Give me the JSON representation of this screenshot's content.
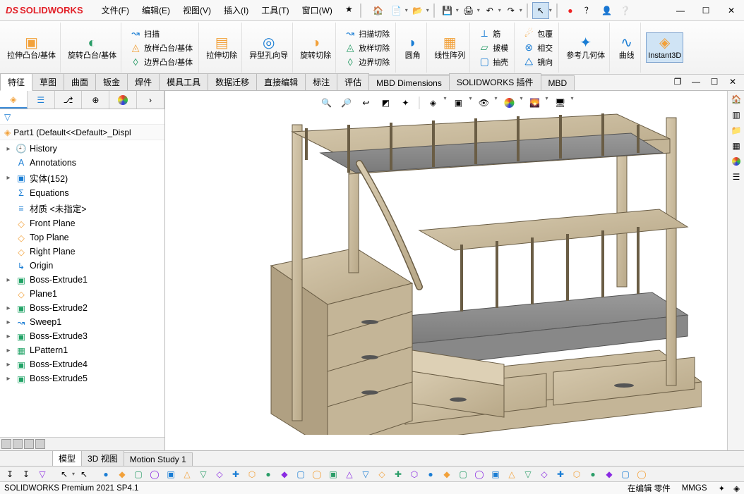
{
  "app": {
    "brand": "SOLIDWORKS"
  },
  "menus": [
    {
      "id": "file",
      "label": "文件(F)"
    },
    {
      "id": "edit",
      "label": "编辑(E)"
    },
    {
      "id": "view",
      "label": "视图(V)"
    },
    {
      "id": "insert",
      "label": "插入(I)"
    },
    {
      "id": "tools",
      "label": "工具(T)"
    },
    {
      "id": "window",
      "label": "窗口(W)"
    },
    {
      "id": "star",
      "label": "★"
    }
  ],
  "ribbon": {
    "extrude": "拉伸凸台/基体",
    "revolve": "旋转凸台/基体",
    "sweep": "扫描",
    "loft": "放样凸台/基体",
    "boundary": "边界凸台/基体",
    "cut_extrude": "拉伸切除",
    "hole": "异型孔向导",
    "cut_revolve": "旋转切除",
    "sweep_cut": "扫描切除",
    "loft_cut": "放样切除",
    "boundary_cut": "边界切除",
    "fillet": "圆角",
    "pattern": "线性阵列",
    "rib": "筋",
    "draft": "拔模",
    "shell": "抽壳",
    "wrap": "包覆",
    "intersect": "相交",
    "mirror": "镜向",
    "refgeo": "参考几何体",
    "curves": "曲线",
    "instant3d": "Instant3D"
  },
  "tabs": {
    "features": "特征",
    "sketch": "草图",
    "surface": "曲面",
    "sheetmetal": "钣金",
    "weld": "焊件",
    "mold": "模具工具",
    "datamig": "数据迁移",
    "directedit": "直接编辑",
    "annotate": "标注",
    "evaluate": "评估",
    "mbd_dim": "MBD Dimensions",
    "swaddins": "SOLIDWORKS 插件",
    "mbd": "MBD"
  },
  "leftpanel": {
    "part_display": "Part1  (Default<<Default>_Displ",
    "nodes": [
      {
        "tw": "▸",
        "icon": "history",
        "color": "#1a7dd4",
        "label": "History"
      },
      {
        "tw": "",
        "icon": "annot",
        "color": "#1a7dd4",
        "label": "Annotations"
      },
      {
        "tw": "▸",
        "icon": "solids",
        "color": "#1a7dd4",
        "label": "实体(152)"
      },
      {
        "tw": "",
        "icon": "eq",
        "color": "#1a7dd4",
        "label": "Equations"
      },
      {
        "tw": "",
        "icon": "mat",
        "color": "#1a7dd4",
        "label": "材质 <未指定>"
      },
      {
        "tw": "",
        "icon": "plane",
        "color": "#f2a13a",
        "label": "Front Plane"
      },
      {
        "tw": "",
        "icon": "plane",
        "color": "#f2a13a",
        "label": "Top Plane"
      },
      {
        "tw": "",
        "icon": "plane",
        "color": "#f2a13a",
        "label": "Right Plane"
      },
      {
        "tw": "",
        "icon": "origin",
        "color": "#1a7dd4",
        "label": "Origin"
      },
      {
        "tw": "▸",
        "icon": "extrude",
        "color": "#21a366",
        "label": "Boss-Extrude1"
      },
      {
        "tw": "",
        "icon": "plane",
        "color": "#f2a13a",
        "label": "Plane1"
      },
      {
        "tw": "▸",
        "icon": "extrude",
        "color": "#21a366",
        "label": "Boss-Extrude2"
      },
      {
        "tw": "▸",
        "icon": "sweep",
        "color": "#1a7dd4",
        "label": "Sweep1"
      },
      {
        "tw": "▸",
        "icon": "extrude",
        "color": "#21a366",
        "label": "Boss-Extrude3"
      },
      {
        "tw": "▸",
        "icon": "pattern",
        "color": "#21a366",
        "label": "LPattern1"
      },
      {
        "tw": "▸",
        "icon": "extrude",
        "color": "#21a366",
        "label": "Boss-Extrude4"
      },
      {
        "tw": "▸",
        "icon": "extrude",
        "color": "#21a366",
        "label": "Boss-Extrude5"
      }
    ]
  },
  "bottomtabs": {
    "model": "模型",
    "view3d": "3D 视图",
    "motion": "Motion Study 1"
  },
  "status": {
    "version": "SOLIDWORKS Premium 2021 SP4.1",
    "edit": "在编辑 零件",
    "units": "MMGS"
  }
}
